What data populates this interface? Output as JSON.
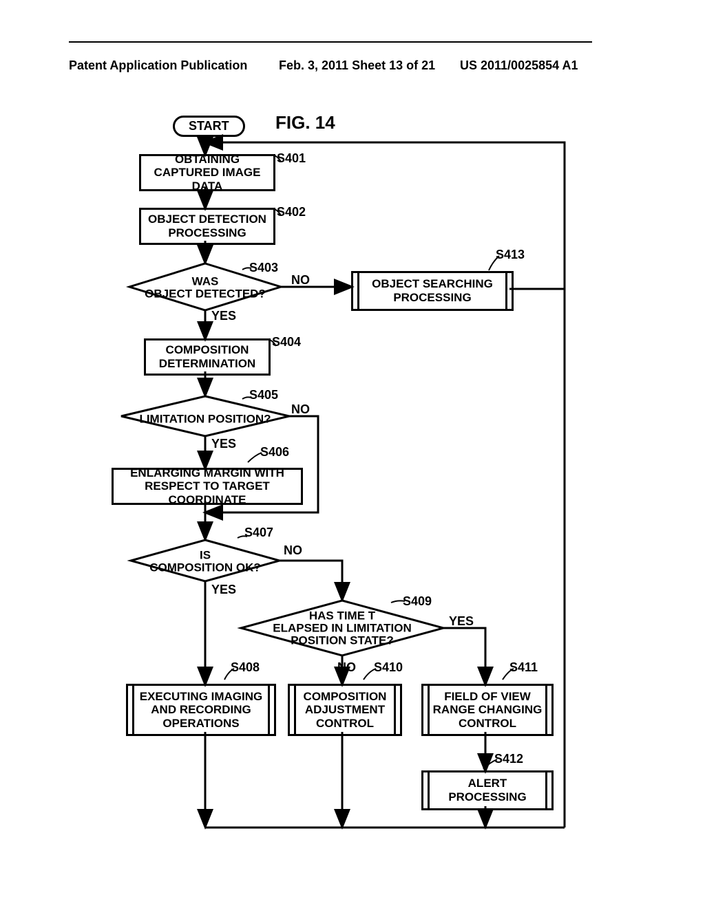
{
  "header": {
    "left": "Patent Application Publication",
    "center": "Feb. 3, 2011  Sheet 13 of 21",
    "right": "US 2011/0025854 A1"
  },
  "figure_title": "FIG. 14",
  "nodes": {
    "start": "START",
    "s401": "OBTAINING CAPTURED IMAGE DATA",
    "s402": "OBJECT DETECTION PROCESSING",
    "s403": "WAS OBJECT DETECTED?",
    "s404": "COMPOSITION DETERMINATION",
    "s405": "LIMITATION POSITION?",
    "s406": "ENLARGING MARGIN WITH RESPECT TO TARGET COORDINATE",
    "s407": "IS COMPOSITION OK?",
    "s408": "EXECUTING IMAGING AND RECORDING OPERATIONS",
    "s409": "HAS TIME T ELAPSED IN LIMITATION POSITION STATE?",
    "s410": "COMPOSITION ADJUSTMENT CONTROL",
    "s411": "FIELD OF VIEW RANGE CHANGING CONTROL",
    "s412": "ALERT PROCESSING",
    "s413": "OBJECT SEARCHING PROCESSING"
  },
  "step_labels": {
    "s401": "S401",
    "s402": "S402",
    "s403": "S403",
    "s404": "S404",
    "s405": "S405",
    "s406": "S406",
    "s407": "S407",
    "s408": "S408",
    "s409": "S409",
    "s410": "S410",
    "s411": "S411",
    "s412": "S412",
    "s413": "S413"
  },
  "answers": {
    "yes": "YES",
    "no": "NO"
  }
}
